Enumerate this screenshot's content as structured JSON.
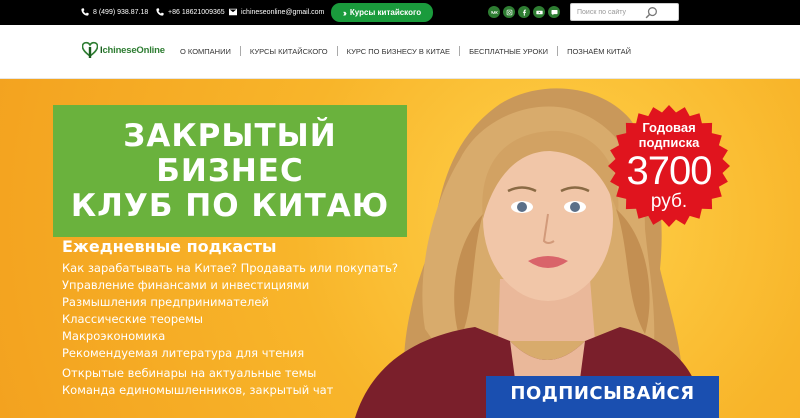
{
  "topbar": {
    "phone1": "8 (499) 938.87.18",
    "phone2": "+86 18621009365",
    "email": "ichineseonline@gmail.com",
    "cta_label": "Курсы китайского",
    "socials": [
      "vk-icon",
      "instagram-icon",
      "facebook-icon",
      "youtube-icon",
      "chat-icon"
    ],
    "search_placeholder": "Поиск по сайту"
  },
  "nav": {
    "logo_prefix": "I",
    "logo_text": "chineseOnline",
    "items": [
      "О КОМПАНИИ",
      "КУРСЫ КИТАЙСКОГО",
      "КУРС ПО БИЗНЕСУ В КИТАЕ",
      "БЕСПЛАТНЫЕ УРОКИ",
      "ПОЗНАЁМ КИТАЙ"
    ]
  },
  "hero": {
    "title_lines": [
      "ЗАКРЫТЫЙ",
      "БИЗНЕС",
      "КЛУБ ПО КИТАЮ"
    ],
    "features_heading": "Ежедневные подкасты",
    "features": [
      "Как зарабатывать на Китае? Продавать или покупать?",
      "Управление финансами и инвестициями",
      "Размышления предпринимателей",
      "Классические теоремы",
      "Макроэкономика",
      "Рекомендуемая литература для чтения",
      "Открытые вебинары на актуальные темы",
      "Команда единомышленников, закрытый чат"
    ],
    "badge": {
      "line1": "Годовая",
      "line2": "подписка",
      "price": "3700",
      "currency": "руб."
    },
    "subscribe_label": "ПОДПИСЫВАЙСЯ"
  },
  "colors": {
    "topbar_bg": "#000000",
    "accent_green": "#1a9b3c",
    "title_box_green": "#6ab23d",
    "hero_yellow": "#f8b52a",
    "badge_red": "#e0141e",
    "subscribe_blue": "#1a4fb0"
  }
}
